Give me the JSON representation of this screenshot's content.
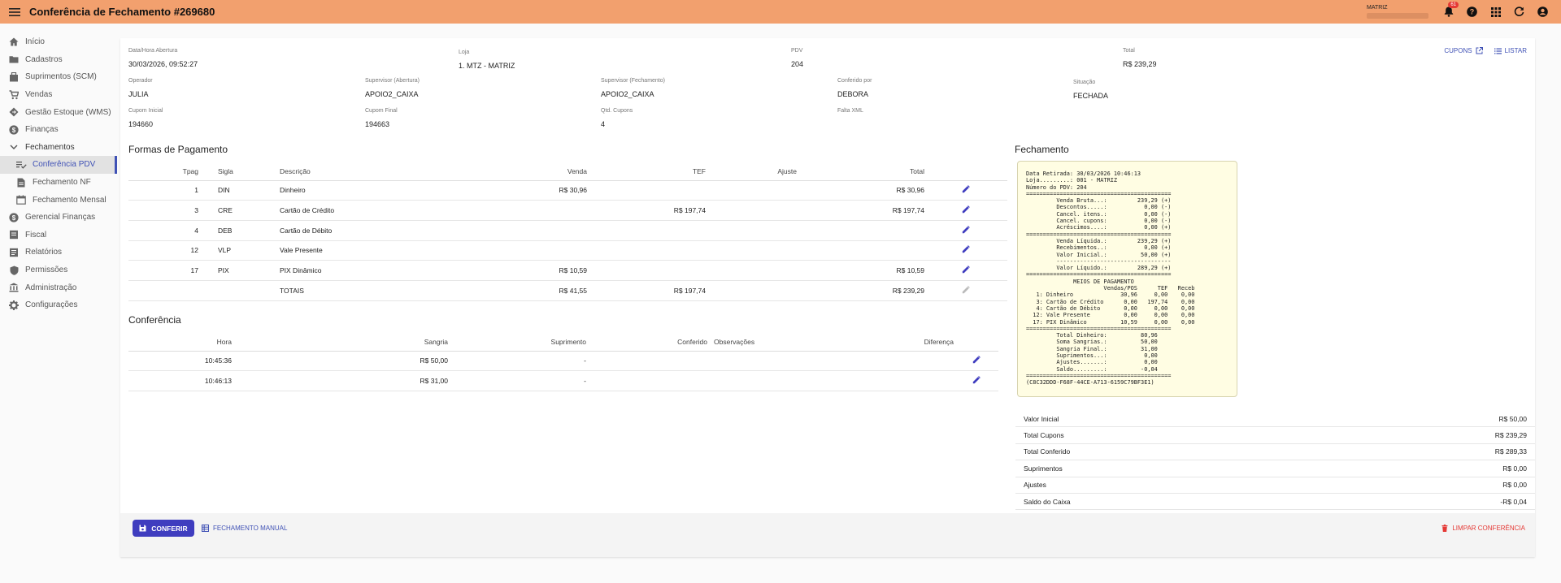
{
  "header": {
    "title": "Conferência de Fechamento #269680",
    "store": "MATRIZ",
    "notif_count": "61"
  },
  "sidebar": {
    "items": [
      {
        "label": "Início",
        "icon": "home-icon"
      },
      {
        "label": "Cadastros",
        "icon": "folder-icon"
      },
      {
        "label": "Suprimentos (SCM)",
        "icon": "box-icon"
      },
      {
        "label": "Vendas",
        "icon": "cart-icon"
      },
      {
        "label": "Gestão Estoque (WMS)",
        "icon": "diamond-icon"
      },
      {
        "label": "Finanças",
        "icon": "dollar-icon"
      },
      {
        "label": "Fechamentos",
        "icon": "chevron-down-icon"
      },
      {
        "label": "Conferência PDV",
        "icon": "list-check-icon"
      },
      {
        "label": "Fechamento NF",
        "icon": "document-icon"
      },
      {
        "label": "Fechamento Mensal",
        "icon": "calendar-icon"
      },
      {
        "label": "Gerencial Finanças",
        "icon": "dollar-icon"
      },
      {
        "label": "Fiscal",
        "icon": "receipt-icon"
      },
      {
        "label": "Relatórios",
        "icon": "report-icon"
      },
      {
        "label": "Permissões",
        "icon": "shield-icon"
      },
      {
        "label": "Administração",
        "icon": "bank-icon"
      },
      {
        "label": "Configurações",
        "icon": "gear-icon"
      }
    ]
  },
  "info": {
    "abertura_label": "Data/Hora Abertura",
    "abertura": "30/03/2026, 09:52:27",
    "loja_label": "Loja",
    "loja": "1. MTZ - MATRIZ",
    "pdv_label": "PDV",
    "pdv": "204",
    "total_label": "Total",
    "total": "R$ 239,29",
    "operador_label": "Operador",
    "operador": "JULIA",
    "sup_abertura_label": "Supervisor (Abertura)",
    "sup_abertura": "APOIO2_CAIXA",
    "sup_fechamento_label": "Supervisor (Fechamento)",
    "sup_fechamento": "APOIO2_CAIXA",
    "conferido_label": "Conferido por",
    "conferido": "DEBORA",
    "situacao_label": "Situação",
    "situacao": "FECHADA",
    "cupom_inicial_label": "Cupom Inicial",
    "cupom_inicial": "194660",
    "cupom_final_label": "Cupom Final",
    "cupom_final": "194663",
    "qtd_cupons_label": "Qtd. Cupons",
    "qtd_cupons": "4",
    "falta_xml_label": "Falta XML",
    "cupons_link": "CUPONS",
    "listar_link": "LISTAR"
  },
  "pagamento": {
    "title": "Formas de Pagamento",
    "headers": [
      "Tpag",
      "Sigla",
      "Descrição",
      "Venda",
      "TEF",
      "Ajuste",
      "Total"
    ],
    "rows": [
      {
        "tpag": "1",
        "sigla": "DIN",
        "descricao": "Dinheiro",
        "venda": "R$ 30,96",
        "tef": "",
        "ajuste": "",
        "total": "R$ 30,96"
      },
      {
        "tpag": "3",
        "sigla": "CRE",
        "descricao": "Cartão de Crédito",
        "venda": "",
        "tef": "R$ 197,74",
        "ajuste": "",
        "total": "R$ 197,74"
      },
      {
        "tpag": "4",
        "sigla": "DEB",
        "descricao": "Cartão de Débito",
        "venda": "",
        "tef": "",
        "ajuste": "",
        "total": ""
      },
      {
        "tpag": "12",
        "sigla": "VLP",
        "descricao": "Vale Presente",
        "venda": "",
        "tef": "",
        "ajuste": "",
        "total": ""
      },
      {
        "tpag": "17",
        "sigla": "PIX",
        "descricao": "PIX Dinâmico",
        "venda": "R$ 10,59",
        "tef": "",
        "ajuste": "",
        "total": "R$ 10,59"
      }
    ],
    "totais": {
      "label": "TOTAIS",
      "venda": "R$ 41,55",
      "tef": "R$ 197,74",
      "total": "R$ 239,29"
    }
  },
  "conferencia": {
    "title": "Conferência",
    "headers": [
      "Hora",
      "Sangria",
      "Suprimento",
      "Conferido",
      "Observações",
      "Diferença"
    ],
    "rows": [
      {
        "hora": "10:45:36",
        "sangria": "R$ 50,00",
        "suprimento": "-"
      },
      {
        "hora": "10:46:13",
        "sangria": "R$ 31,00",
        "suprimento": "-"
      }
    ]
  },
  "fechamento": {
    "title": "Fechamento",
    "receipt": "Data Retirada: 30/03/2026 10:46:13\nLoja.........: 001 - MATRIZ\nNúmero do PDV: 204\n===========================================\n         Venda Bruta...:         239,29 (+)\n         Descontos.....:           0,00 (-)\n         Cancel. itens.:           0,00 (-)\n         Cancel. cupons:           0,00 (-)\n         Acréscimos....:           0,00 (+)\n===========================================\n         Venda Líquida.:         239,29 (+)\n         Recebimentos..:           0,00 (+)\n         Valor Inicial.:          50,00 (+)\n         ----------------------------------\n         Valor Líquido.:         289,29 (+)\n===========================================\n              MEIOS DE PAGAMENTO\n                       Vendas/POS      TEF   Receb\n   1: Dinheiro              30,96     0,00    0,00\n   3: Cartão de Crédito      0,00   197,74    0,00\n   4: Cartão de Débito       0,00     0,00    0,00\n  12: Vale Presente          0,00     0,00    0,00\n  17: PIX Dinâmico          10,59     0,00    0,00\n===========================================\n         Total Dinheiro:          80,96\n         Soma Sangrias.:          50,00\n         Sangria Final.:          31,00\n         Suprimentos...:           0,00\n         Ajustes.......:           0,00\n         Saldo.........:          -0,04\n===========================================\n(C8C32DDD-F68F-44CE-A713-6159C79BF3E1)",
    "summary": [
      {
        "label": "Valor Inicial",
        "value": "R$ 50,00"
      },
      {
        "label": "Total Cupons",
        "value": "R$ 239,29"
      },
      {
        "label": "Total Conferido",
        "value": "R$ 289,33"
      },
      {
        "label": "Suprimentos",
        "value": "R$ 0,00"
      },
      {
        "label": "Ajustes",
        "value": "R$ 0,00"
      },
      {
        "label": "Saldo do Caixa",
        "value": "-R$ 0,04"
      }
    ]
  },
  "footer": {
    "conferir": "CONFERIR",
    "manual": "FECHAMENTO MANUAL",
    "limpar": "LIMPAR CONFERÊNCIA"
  },
  "colors": {
    "topbar": "#f2a06e",
    "primary": "#3f3dbf",
    "danger": "#e53935",
    "receipt_bg": "#fffde3"
  }
}
